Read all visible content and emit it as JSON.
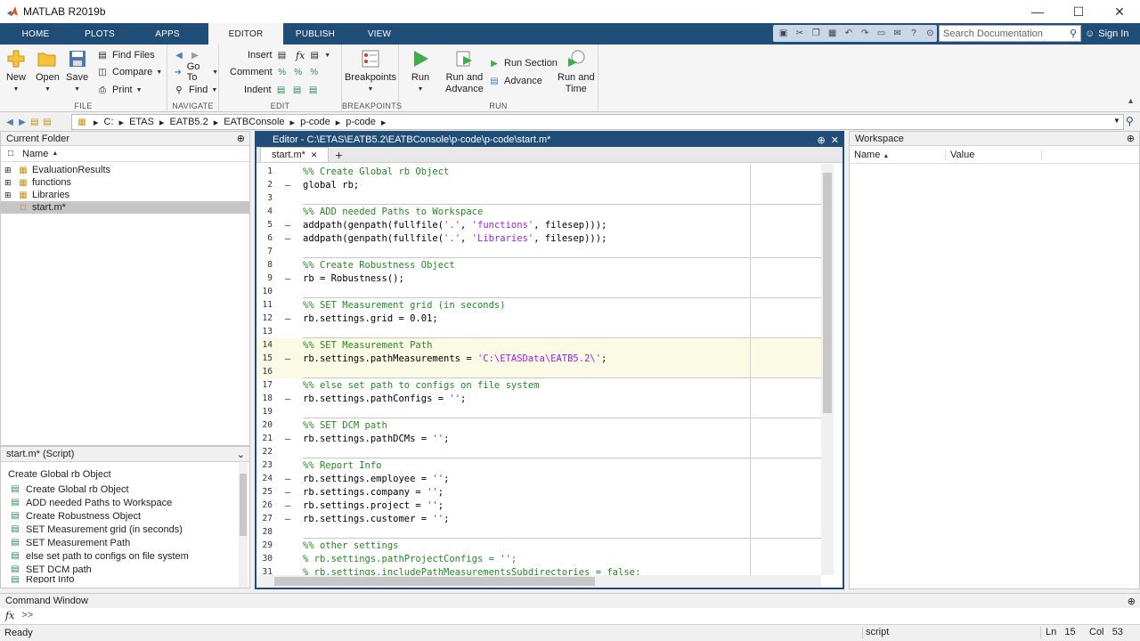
{
  "window": {
    "title": "MATLAB R2019b"
  },
  "tabs": [
    "HOME",
    "PLOTS",
    "APPS",
    "EDITOR",
    "PUBLISH",
    "VIEW"
  ],
  "active_tab": "EDITOR",
  "search": {
    "placeholder": "Search Documentation"
  },
  "signin_label": "Sign In",
  "ribbon": {
    "file": {
      "label": "FILE",
      "new": "New",
      "open": "Open",
      "save": "Save",
      "find_files": "Find Files",
      "compare": "Compare",
      "print": "Print"
    },
    "navigate": {
      "label": "NAVIGATE",
      "goto": "Go To",
      "find": "Find"
    },
    "edit": {
      "label": "EDIT",
      "insert": "Insert",
      "comment": "Comment",
      "indent": "Indent",
      "fx": "fx"
    },
    "breakpoints": {
      "label": "BREAKPOINTS",
      "button": "Breakpoints"
    },
    "run": {
      "label": "RUN",
      "run": "Run",
      "run_advance_1": "Run and",
      "run_advance_2": "Advance",
      "run_section": "Run Section",
      "advance": "Advance",
      "run_time_1": "Run and",
      "run_time_2": "Time"
    }
  },
  "path": [
    "C:",
    "ETAS",
    "EATB5.2",
    "EATBConsole",
    "p-code",
    "p-code"
  ],
  "current_folder": {
    "title": "Current Folder",
    "column": "Name",
    "items": [
      "EvaluationResults",
      "functions",
      "Libraries",
      "start.m*"
    ]
  },
  "details": {
    "title": "start.m* (Script)",
    "heading": "Create Global rb Object",
    "items": [
      "Create Global rb Object",
      "ADD needed Paths to Workspace",
      "Create Robustness Object",
      "SET Measurement grid (in seconds)",
      "SET Measurement Path",
      "else set path to configs on file system",
      "SET DCM path",
      "Report Info"
    ]
  },
  "editor": {
    "title": "Editor - C:\\ETAS\\EATB5.2\\EATBConsole\\p-code\\p-code\\start.m*",
    "tab": "start.m*",
    "lines": [
      {
        "n": "1",
        "text": "%% Create Global rb Object"
      },
      {
        "n": "2",
        "text": "global rb;"
      },
      {
        "n": "3",
        "text": ""
      },
      {
        "n": "4",
        "text": "%% ADD needed Paths to Workspace"
      },
      {
        "n": "5",
        "text": "addpath(genpath(fullfile('.', 'functions', filesep)));"
      },
      {
        "n": "6",
        "text": "addpath(genpath(fullfile('.', 'Libraries', filesep)));"
      },
      {
        "n": "7",
        "text": ""
      },
      {
        "n": "8",
        "text": "%% Create Robustness Object"
      },
      {
        "n": "9",
        "text": "rb = Robustness();"
      },
      {
        "n": "10",
        "text": ""
      },
      {
        "n": "11",
        "text": "%% SET Measurement grid (in seconds)"
      },
      {
        "n": "12",
        "text": "rb.settings.grid = 0.01;"
      },
      {
        "n": "13",
        "text": ""
      },
      {
        "n": "14",
        "text": "%% SET Measurement Path"
      },
      {
        "n": "15",
        "text": "rb.settings.pathMeasurements = 'C:\\ETASData\\EATB5.2\\';"
      },
      {
        "n": "16",
        "text": ""
      },
      {
        "n": "17",
        "text": "%% else set path to configs on file system"
      },
      {
        "n": "18",
        "text": "rb.settings.pathConfigs = '';"
      },
      {
        "n": "19",
        "text": ""
      },
      {
        "n": "20",
        "text": "%% SET DCM path"
      },
      {
        "n": "21",
        "text": "rb.settings.pathDCMs = '';"
      },
      {
        "n": "22",
        "text": ""
      },
      {
        "n": "23",
        "text": "%% Report Info"
      },
      {
        "n": "24",
        "text": "rb.settings.employee = '';"
      },
      {
        "n": "25",
        "text": "rb.settings.company = '';"
      },
      {
        "n": "26",
        "text": "rb.settings.project = '';"
      },
      {
        "n": "27",
        "text": "rb.settings.customer = '';"
      },
      {
        "n": "28",
        "text": ""
      },
      {
        "n": "29",
        "text": "%% other settings"
      },
      {
        "n": "30",
        "text": "% rb.settings.pathProjectConfigs = '';"
      },
      {
        "n": "31",
        "text": "% rb.settings.includePathMeasurementsSubdirectories = false;"
      }
    ]
  },
  "workspace": {
    "title": "Workspace",
    "col_name": "Name",
    "col_value": "Value"
  },
  "command_window": {
    "title": "Command Window",
    "prompt": ">>",
    "fx": "fx"
  },
  "status": {
    "text": "Ready",
    "type": "script",
    "ln_label": "Ln",
    "ln": "15",
    "col_label": "Col",
    "col": "53"
  }
}
